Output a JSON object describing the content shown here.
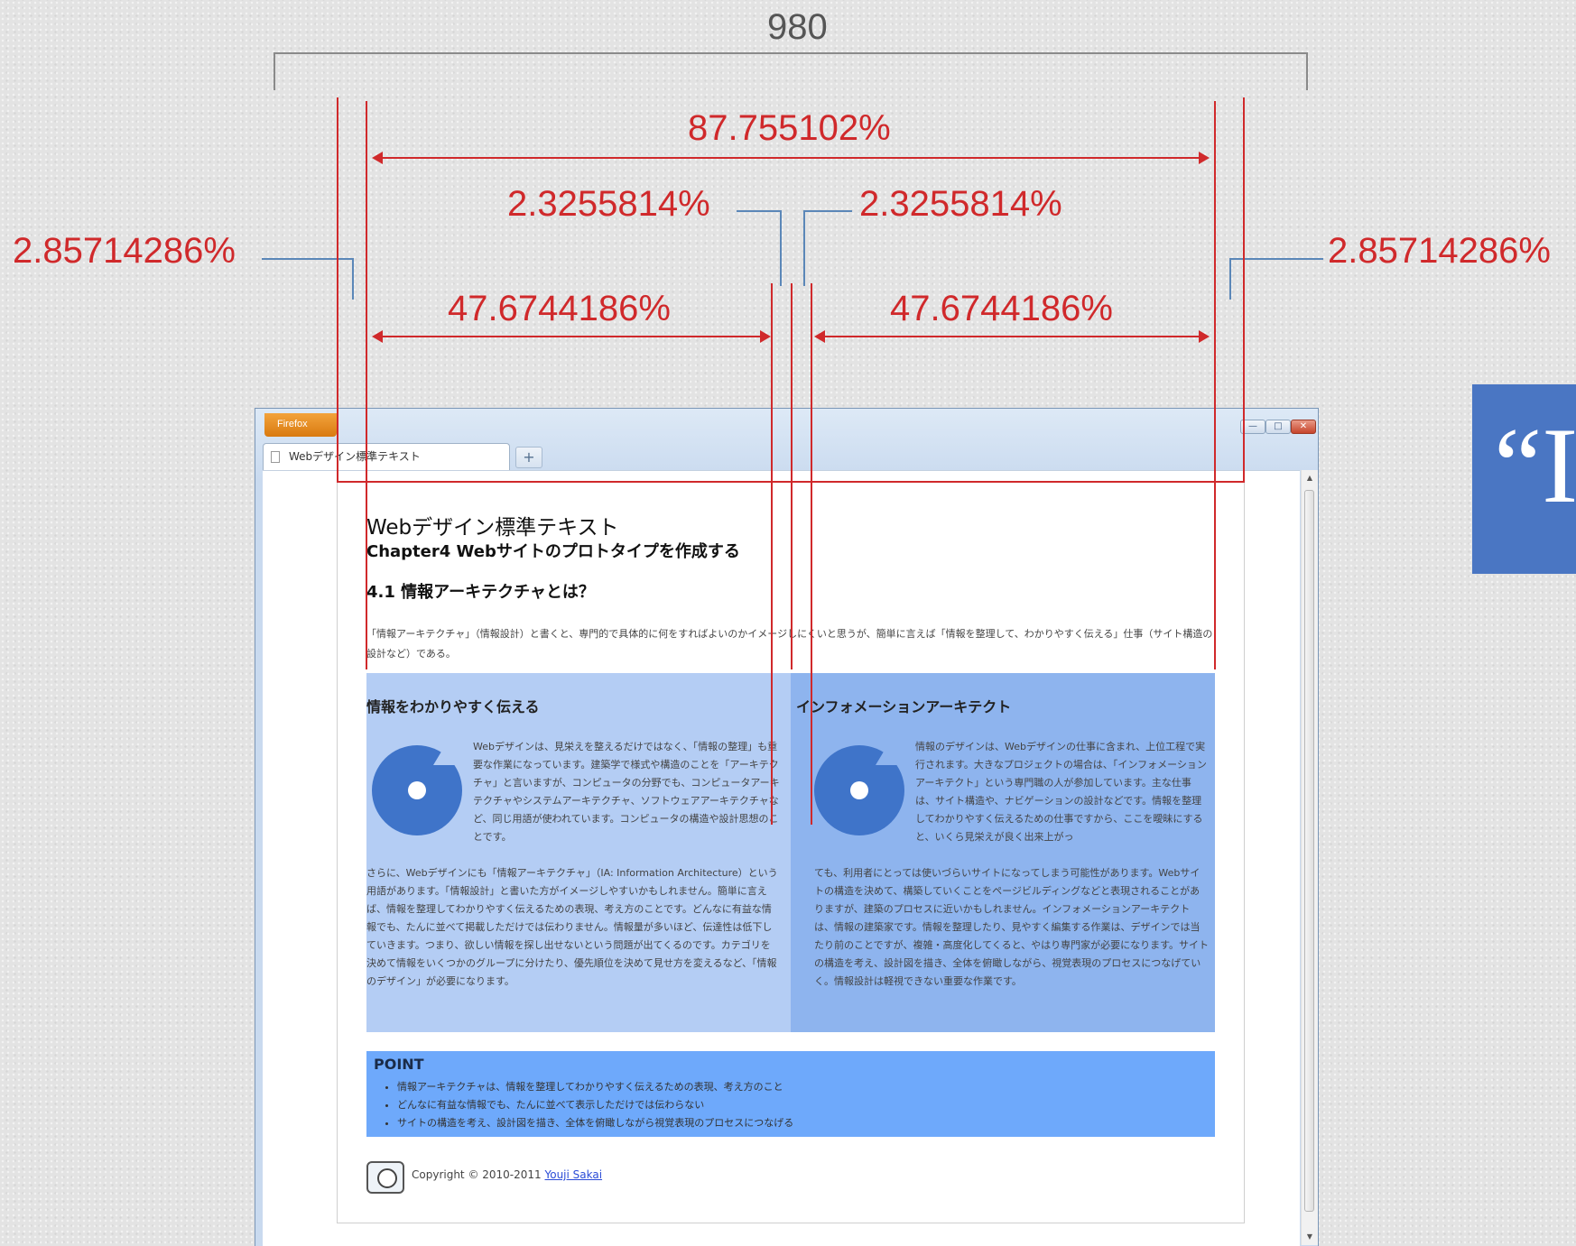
{
  "annotations": {
    "total_width": "980",
    "main_percent": "87.755102%",
    "gap_left_percent": "2.3255814%",
    "gap_right_percent": "2.3255814%",
    "margin_left_percent": "2.85714286%",
    "margin_right_percent": "2.85714286%",
    "col_left_percent": "47.6744186%",
    "col_right_percent": "47.6744186%"
  },
  "browser": {
    "menu_button": "Firefox",
    "tab_title": "Webデザイン標準テキスト",
    "new_tab": "+",
    "controls": {
      "minimize": "—",
      "maximize": "□",
      "close": "✕"
    }
  },
  "page": {
    "title": "Webデザイン標準テキスト",
    "subtitle": "Chapter4 Webサイトのプロトタイプを作成する",
    "section": "4.1 情報アーキテクチャとは？",
    "intro": "「情報アーキテクチャ」（情報設計）と書くと、専門的で具体的に何をすればよいのかイメージしにくいと思うが、簡単に言えば「情報を整理して、わかりやすく伝える」仕事（サイト構造の設計など）である。",
    "left_col": {
      "heading": "情報をわかりやすく伝える",
      "para1": "Webデザインは、見栄えを整えるだけではなく、「情報の整理」も重要な作業になっています。建築学で様式や構造のことを「アーキテクチャ」と言いますが、コンピュータの分野でも、コンピュータアーキテクチャやシステムアーキテクチャ、ソフトウェアアーキテクチャなど、同じ用語が使われています。コンピュータの構造や設計思想のことです。",
      "para2": "さらに、Webデザインにも「情報アーキテクチャ」（IA: Information Architecture）という用語があります。「情報設計」と書いた方がイメージしやすいかもしれません。簡単に言えば、情報を整理してわかりやすく伝えるための表現、考え方のことです。どんなに有益な情報でも、たんに並べて掲載しただけでは伝わりません。情報量が多いほど、伝達性は低下していきます。つまり、欲しい情報を探し出せないという問題が出てくるのです。カテゴリを決めて情報をいくつかのグループに分けたり、優先順位を決めて見せ方を変えるなど、「情報のデザイン」が必要になります。"
    },
    "right_col": {
      "heading": "インフォメーションアーキテクト",
      "para1": "情報のデザインは、Webデザインの仕事に含まれ、上位工程で実行されます。大きなプロジェクトの場合は、「インフォメーションアーキテクト」という専門職の人が参加しています。主な仕事は、サイト構造や、ナビゲーションの設計などです。情報を整理してわかりやすく伝えるための仕事ですから、ここを曖昧にすると、いくら見栄えが良く出来上がっ",
      "para2": "ても、利用者にとっては使いづらいサイトになってしまう可能性があります。Webサイトの構造を決めて、構築していくことをページビルディングなどと表現されることがありますが、建築のプロセスに近いかもしれません。インフォメーションアーキテクトは、情報の建築家です。情報を整理したり、見やすく編集する作業は、デザインでは当たり前のことですが、複雑・高度化してくると、やはり専門家が必要になります。サイトの構造を考え、設計図を描き、全体を俯瞰しながら、視覚表現のプロセスにつなげていく。情報設計は軽視できない重要な作業です。"
    },
    "point": {
      "heading": "POINT",
      "items": [
        "情報アーキテクチャは、情報を整理してわかりやすく伝えるための表現、考え方のこと",
        "どんなに有益な情報でも、たんに並べて表示しただけでは伝わらない",
        "サイトの構造を考え、設計図を描き、全体を俯瞰しながら視覚表現のプロセスにつなげる"
      ]
    },
    "footer": {
      "copyright": "Copyright © 2010-2011",
      "author": "Youji Sakai"
    }
  },
  "quote_box": {
    "text": "“I"
  },
  "colors": {
    "accent_red": "#d0292b",
    "left_col_bg": "#b4cdf4",
    "right_col_bg": "#8eb4ee",
    "point_bg": "#6ea9fb"
  }
}
